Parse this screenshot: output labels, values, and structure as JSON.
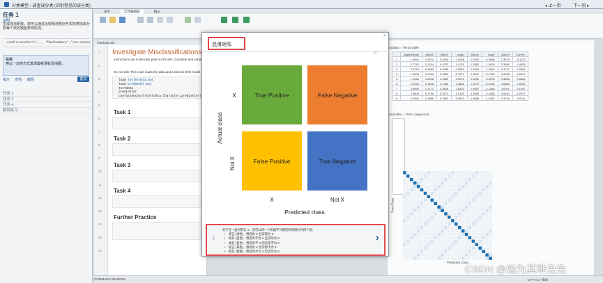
{
  "topbar": {
    "breadcrumb": "分类模型 › 调查误分类 (识别常见的误分类)",
    "prev": "◂ 上一页",
    "next": "下一页 ▸"
  },
  "leftpane": {
    "title": "任务 1",
    "subtitle": "说明",
    "desc": "生成混淆矩阵。您可以通过比较预测类别与实际类别来分析每个类的模型表现情况。",
    "code_line": "confusionchart(..., \"RowSummary\",\"row-normalized\")",
    "taskbox_title": "任务",
    "taskbox_text": "用以一次的方式发现最新误标混淆图。",
    "links": [
      "提示",
      "查看",
      "解题"
    ],
    "submit": "提交",
    "tasks": [
      "任务 2",
      "任务 3",
      "任务 4",
      "解锁练习"
    ]
  },
  "tabs": [
    "主页",
    "实时编辑器",
    "插入"
  ],
  "doc": {
    "filename": "misclass.mlx",
    "heading": "Investigate Misclassifications",
    "intro": "Instructions are in the task pane to the left. Complete and submit each task one at a time.",
    "warn": "Do not edit. This code loads the data and a trained kNN model.",
    "code": [
      "load letterdata.mat",
      "load predmodel.mat",
      "testdata",
      "predLetter",
      "confusionchart(testdata.Character,predLetter);"
    ],
    "line_numbers": [
      "1",
      "2",
      "3",
      "4",
      "5",
      "6",
      "7",
      "8",
      "9",
      "10",
      "11",
      "12",
      "13",
      "14",
      "15",
      "16"
    ],
    "tasks": [
      "Task 1",
      "Task 2",
      "Task 3",
      "Task 4",
      "Further Practice"
    ]
  },
  "workspace": {
    "var1": "testdata = 78×25 table",
    "columns": [
      "AspectRatio",
      "MADX",
      "MADY",
      "AvgU",
      "MADU",
      "AvgV",
      "MADV",
      "CorrXY"
    ],
    "rows": [
      [
        "1",
        "1.4054",
        "0.1872",
        "0.3153",
        "0.6768",
        "1.9292",
        "-0.0588",
        "2.3573",
        "-0.1112"
      ],
      [
        "2",
        "2.7742",
        "0.1314",
        "0.4757",
        "0.4211",
        "1.2962",
        "1.5929",
        "3.3080",
        "0.4628"
      ],
      [
        "3",
        "2.0778",
        "0.1683",
        "0.4346",
        "-0.8350",
        "1.9255",
        "-1.4524",
        "2.4717",
        "0.2895"
      ],
      [
        "4",
        "1.6205",
        "0.1069",
        "0.3892",
        "-0.7977",
        "0.6547",
        "-2.1752",
        "3.4036",
        "0.6417"
      ],
      [
        "5",
        "1.1564",
        "0.2896",
        "0.2562",
        "0.5915",
        "0.5930",
        "-0.5578",
        "3.4898",
        "0.6663"
      ],
      [
        "6",
        "2.9425",
        "0.1848",
        "0.4455",
        "0.2856",
        "1.0279",
        "-0.5415",
        "4.6389",
        "0.6249"
      ],
      [
        "7",
        "3.6695",
        "0.1172",
        "0.5628",
        "0.8443",
        "1.4687",
        "-4.1848",
        "4.6011",
        "-0.1007"
      ],
      [
        "8",
        "2.4600",
        "0.1750",
        "0.4071",
        "1.3100",
        "2.1509",
        "-2.2083",
        "3.0452",
        "-0.2677"
      ],
      [
        "9",
        "2.2454",
        "0.1880",
        "0.3597",
        "0.0620",
        "1.6685",
        "-1.4187",
        "2.4734",
        "0.0111"
      ]
    ],
    "var2": "predLetter = 78×1 categorical",
    "heat_xlabel": "Predicted Class",
    "heat_ylabel": "True Class"
  },
  "statusbar": {
    "command_window": "COMMAND WINDOW",
    "position": "UTF-8  LF  脚本"
  },
  "watermark": "CSDN @勉为其难免免",
  "modal": {
    "title": "混淆矩阵",
    "close": "×",
    "cells": {
      "tp": "True Positive",
      "fn": "False Negative",
      "fp": "False Positive",
      "tn": "True Negative"
    },
    "row_labels": [
      "X",
      "Not X"
    ],
    "col_labels": [
      "X",
      "Not X"
    ],
    "ylabel": "Actual class",
    "xlabel": "Predicted class",
    "colors": {
      "tp": "#6aaa3c",
      "fn": "#ed7d31",
      "fp": "#ffc000",
      "tn": "#4472c4",
      "highlight": "#e04b4b"
    },
    "info_intro": "对于任一类别而言 X，您可以将一个机器学习模型的预测分为四个组：",
    "info_items": [
      "真正 (绿色) - 预测为 X 且实际为 X",
      "假负 (蓝色) - 预测为不为 X 且实际为 X",
      "真负 (蓝色) - 预测为不 X 但实际不为 X",
      "假正 (黄色) - 预测为 X 但实际不为 X",
      "假负 (橙色) - 预测为不为 X 但实际为 X"
    ],
    "prev_icon": "‹",
    "next_icon": "›"
  }
}
